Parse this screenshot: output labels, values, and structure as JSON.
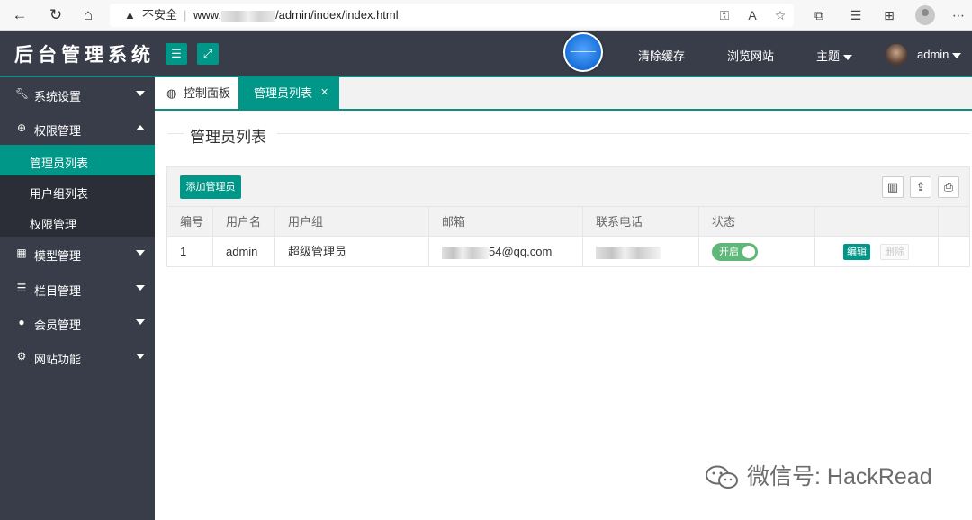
{
  "browser": {
    "security_label": "不安全",
    "url": "www.",
    "url_path": "/admin/index/index.html",
    "icons": [
      "back-icon",
      "refresh-icon",
      "home-icon",
      "key-icon",
      "read-aloud-icon",
      "favorite-add-icon",
      "extensions-icon",
      "favorites-icon",
      "collections-icon",
      "profile-icon",
      "more-icon"
    ]
  },
  "header": {
    "logo": "后台管理系统",
    "clear_cache": "清除缓存",
    "browse_site": "浏览网站",
    "theme": "主题",
    "username": "admin"
  },
  "sidebar": {
    "items": [
      {
        "label": "系统设置",
        "icon": "wrench-icon"
      },
      {
        "label": "权限管理",
        "icon": "globe-icon"
      },
      {
        "label": "模型管理",
        "icon": "grid-icon"
      },
      {
        "label": "栏目管理",
        "icon": "list-icon"
      },
      {
        "label": "会员管理",
        "icon": "user-icon"
      },
      {
        "label": "网站功能",
        "icon": "gear-icon"
      }
    ],
    "subitems": [
      {
        "label": "管理员列表"
      },
      {
        "label": "用户组列表"
      },
      {
        "label": "权限管理"
      }
    ]
  },
  "tabs": {
    "home": "控制面板",
    "active": "管理员列表"
  },
  "page": {
    "title": "管理员列表",
    "add_button": "添加管理员"
  },
  "table": {
    "headers": [
      "编号",
      "用户名",
      "用户组",
      "邮箱",
      "联系电话",
      "状态"
    ],
    "rows": [
      {
        "id": "1",
        "username": "admin",
        "group": "超级管理员",
        "email": "54@qq.com",
        "phone": "",
        "status": "开启",
        "edit": "编辑",
        "delete": "删除"
      }
    ]
  },
  "watermark": {
    "text": "微信号: HackRead"
  },
  "colors": {
    "header_bg": "#393d49",
    "accent": "#009688",
    "switch_on": "#5fb878"
  }
}
